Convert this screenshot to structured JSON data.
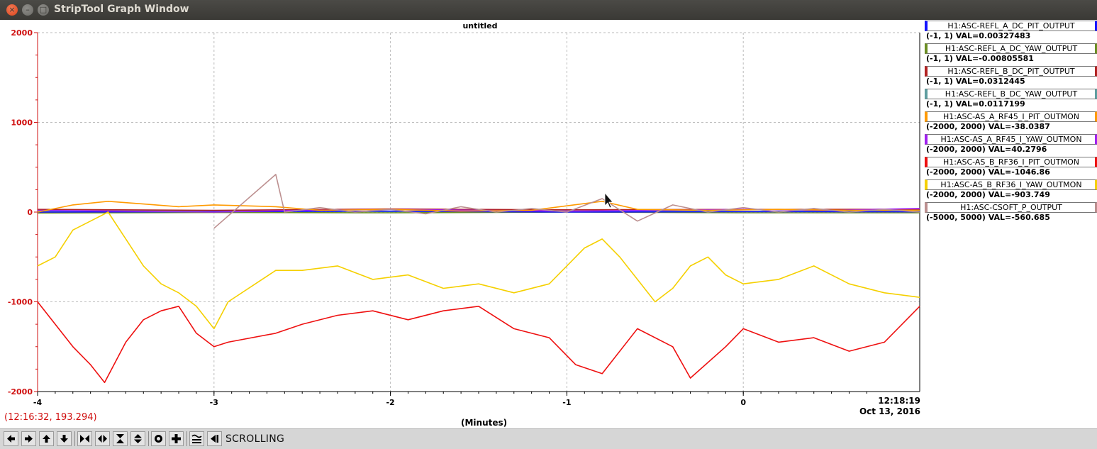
{
  "window": {
    "title": "StripTool Graph Window",
    "controls": [
      "close-icon",
      "minimize-icon",
      "maximize-icon"
    ]
  },
  "graph": {
    "title": "untitled",
    "coord_readout": "(12:16:32, 193.294)",
    "x_unit": "(Minutes)",
    "timestamp_time": "12:18:19",
    "timestamp_date": "Oct 13, 2016",
    "axis_color": "#d01010"
  },
  "legend": [
    {
      "name": "H1:ASC-REFL_A_DC_PIT_OUTPUT",
      "value": "(-1, 1) VAL=0.00327483",
      "color": "#1414ff"
    },
    {
      "name": "H1:ASC-REFL_A_DC_YAW_OUTPUT",
      "value": "(-1, 1) VAL=-0.00805581",
      "color": "#6b8e23"
    },
    {
      "name": "H1:ASC-REFL_B_DC_PIT_OUTPUT",
      "value": "(-1, 1) VAL=0.0312445",
      "color": "#b22222"
    },
    {
      "name": "H1:ASC-REFL_B_DC_YAW_OUTPUT",
      "value": "(-1, 1) VAL=0.0117199",
      "color": "#5f9ea0"
    },
    {
      "name": "H1:ASC-AS_A_RF45_I_PIT_OUTMON",
      "value": "(-2000, 2000) VAL=-38.0387",
      "color": "#ff9a00"
    },
    {
      "name": "H1:ASC-AS_A_RF45_I_YAW_OUTMON",
      "value": "(-2000, 2000) VAL=40.2796",
      "color": "#a020f0"
    },
    {
      "name": "H1:ASC-AS_B_RF36_I_PIT_OUTMON",
      "value": "(-2000, 2000) VAL=-1046.86",
      "color": "#ee1010"
    },
    {
      "name": "H1:ASC-AS_B_RF36_I_YAW_OUTMON",
      "value": "(-2000, 2000) VAL=-903.749",
      "color": "#f5d000"
    },
    {
      "name": "H1:ASC-CSOFT_P_OUTPUT",
      "value": "(-5000, 5000) VAL=-560.685",
      "color": "#bc8f8f"
    }
  ],
  "toolbar": {
    "mode_label": "SCROLLING",
    "buttons": [
      "pan-left-icon",
      "pan-right-icon",
      "pan-up-icon",
      "pan-down-icon",
      "zoom-in-x-icon",
      "zoom-out-x-icon",
      "zoom-in-y-icon",
      "zoom-out-y-icon",
      "reset-icon",
      "refresh-icon",
      "auto-scale-icon",
      "pause-icon"
    ]
  },
  "chart_data": {
    "type": "line",
    "title": "untitled",
    "xlabel": "(Minutes)",
    "ylabel": "",
    "xlim": [
      -4,
      1
    ],
    "ylim": [
      -2000,
      2000
    ],
    "x_ticks": [
      -4,
      -3,
      -2,
      -1,
      0
    ],
    "y_ticks": [
      2000,
      1000,
      0,
      -1000,
      -2000
    ],
    "grid": true,
    "legend_position": "right",
    "series": [
      {
        "name": "H1:ASC-AS_B_RF36_I_PIT_OUTMON",
        "color": "#ee1010",
        "x": [
          -4.0,
          -3.9,
          -3.8,
          -3.7,
          -3.62,
          -3.5,
          -3.4,
          -3.3,
          -3.2,
          -3.1,
          -3.0,
          -2.92,
          -2.65,
          -2.5,
          -2.3,
          -2.1,
          -1.9,
          -1.7,
          -1.5,
          -1.3,
          -1.1,
          -0.95,
          -0.8,
          -0.6,
          -0.4,
          -0.3,
          -0.1,
          0.0,
          0.2,
          0.4,
          0.6,
          0.8,
          1.0
        ],
        "y": [
          -1000,
          -1250,
          -1500,
          -1700,
          -1900,
          -1450,
          -1200,
          -1100,
          -1050,
          -1350,
          -1500,
          -1450,
          -1350,
          -1250,
          -1150,
          -1100,
          -1200,
          -1100,
          -1050,
          -1300,
          -1400,
          -1700,
          -1800,
          -1300,
          -1500,
          -1850,
          -1500,
          -1300,
          -1450,
          -1400,
          -1550,
          -1450,
          -1050
        ]
      },
      {
        "name": "H1:ASC-AS_B_RF36_I_YAW_OUTMON",
        "color": "#f5d000",
        "x": [
          -4.0,
          -3.9,
          -3.8,
          -3.7,
          -3.6,
          -3.5,
          -3.4,
          -3.3,
          -3.2,
          -3.1,
          -3.0,
          -2.92,
          -2.65,
          -2.5,
          -2.3,
          -2.1,
          -1.9,
          -1.7,
          -1.5,
          -1.3,
          -1.1,
          -1.0,
          -0.9,
          -0.8,
          -0.7,
          -0.6,
          -0.5,
          -0.4,
          -0.3,
          -0.2,
          -0.1,
          0.0,
          0.2,
          0.4,
          0.6,
          0.8,
          1.0
        ],
        "y": [
          -600,
          -500,
          -200,
          -100,
          0,
          -300,
          -600,
          -800,
          -900,
          -1050,
          -1300,
          -1000,
          -650,
          -650,
          -600,
          -750,
          -700,
          -850,
          -800,
          -900,
          -800,
          -600,
          -400,
          -300,
          -500,
          -750,
          -1000,
          -850,
          -600,
          -500,
          -700,
          -800,
          -750,
          -600,
          -800,
          -900,
          -950
        ]
      },
      {
        "name": "H1:ASC-CSOFT_P_OUTPUT",
        "color": "#bc8f8f",
        "x": [
          -3.0,
          -2.65,
          -2.6,
          -2.4,
          -2.2,
          -2.0,
          -1.8,
          -1.6,
          -1.4,
          -1.2,
          -1.0,
          -0.8,
          -0.6,
          -0.4,
          -0.2,
          0.0,
          0.2,
          0.4,
          0.6,
          0.8,
          1.0
        ],
        "y": [
          -180,
          420,
          0,
          50,
          0,
          30,
          -20,
          60,
          0,
          40,
          0,
          150,
          -100,
          80,
          0,
          50,
          0,
          40,
          0,
          30,
          0
        ]
      },
      {
        "name": "H1:ASC-AS_A_RF45_I_PIT_OUTMON",
        "color": "#ff9a00",
        "x": [
          -4.0,
          -3.8,
          -3.6,
          -3.4,
          -3.2,
          -3.0,
          -2.65,
          -2.4,
          -2.0,
          -1.6,
          -1.2,
          -0.8,
          -0.6,
          -0.2,
          0.2,
          0.6,
          1.0
        ],
        "y": [
          0,
          80,
          120,
          90,
          60,
          80,
          60,
          20,
          30,
          10,
          20,
          120,
          30,
          20,
          30,
          20,
          20
        ]
      },
      {
        "name": "H1:ASC-AS_A_RF45_I_YAW_OUTMON",
        "color": "#a020f0",
        "x": [
          -4.0,
          -3.5,
          -3.0,
          -2.5,
          -2.0,
          -1.5,
          -1.0,
          -0.5,
          0.0,
          0.5,
          1.0
        ],
        "y": [
          20,
          10,
          0,
          20,
          30,
          20,
          10,
          20,
          30,
          20,
          40
        ]
      },
      {
        "name": "H1:ASC-REFL_A_DC_PIT_OUTPUT",
        "color": "#1414ff",
        "x": [
          -4.0,
          -3.0,
          -2.0,
          -1.0,
          0.0,
          1.0
        ],
        "y": [
          0,
          5,
          10,
          0,
          5,
          3
        ]
      },
      {
        "name": "H1:ASC-REFL_A_DC_YAW_OUTPUT",
        "color": "#6b8e23",
        "x": [
          -4.0,
          -3.0,
          -2.0,
          -1.0,
          0.0,
          1.0
        ],
        "y": [
          -10,
          -5,
          -8,
          0,
          -8,
          -8
        ]
      },
      {
        "name": "H1:ASC-REFL_B_DC_PIT_OUTPUT",
        "color": "#b22222",
        "x": [
          -4.0,
          -3.0,
          -2.0,
          -1.0,
          0.0,
          1.0
        ],
        "y": [
          30,
          20,
          35,
          25,
          30,
          31
        ]
      },
      {
        "name": "H1:ASC-REFL_B_DC_YAW_OUTPUT",
        "color": "#5f9ea0",
        "x": [
          -4.0,
          -3.0,
          -2.0,
          -1.0,
          0.0,
          1.0
        ],
        "y": [
          10,
          15,
          5,
          12,
          8,
          12
        ]
      }
    ]
  }
}
